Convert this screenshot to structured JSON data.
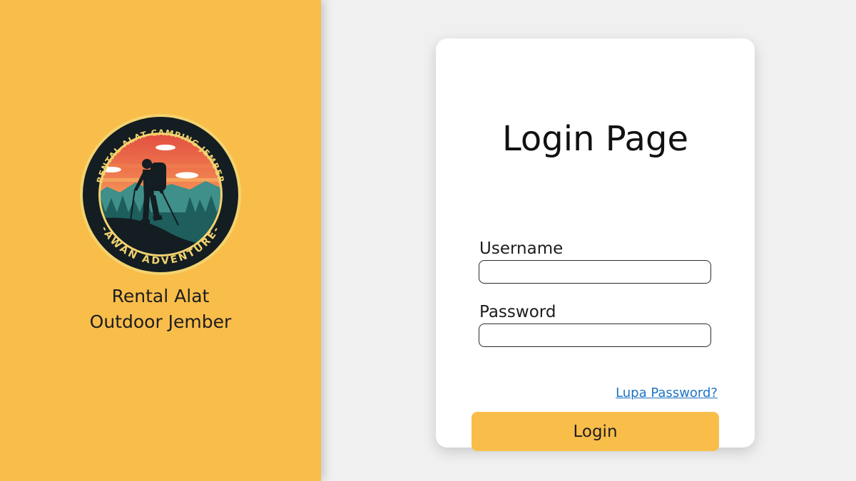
{
  "brand": {
    "logo_top_text": "RENTAL ALAT CAMPING JEMBER",
    "logo_bottom_text": "-AWAN ADVENTURE-",
    "tagline_line1": "Rental Alat",
    "tagline_line2": "Outdoor Jember",
    "panel_color": "#f9bd4a"
  },
  "login": {
    "title": "Login Page",
    "username_label": "Username",
    "username_value": "",
    "password_label": "Password",
    "password_value": "",
    "forgot_password": "Lupa Password?",
    "submit_label": "Login",
    "accent_color": "#f9bd4a",
    "link_color": "#1e73c4"
  }
}
